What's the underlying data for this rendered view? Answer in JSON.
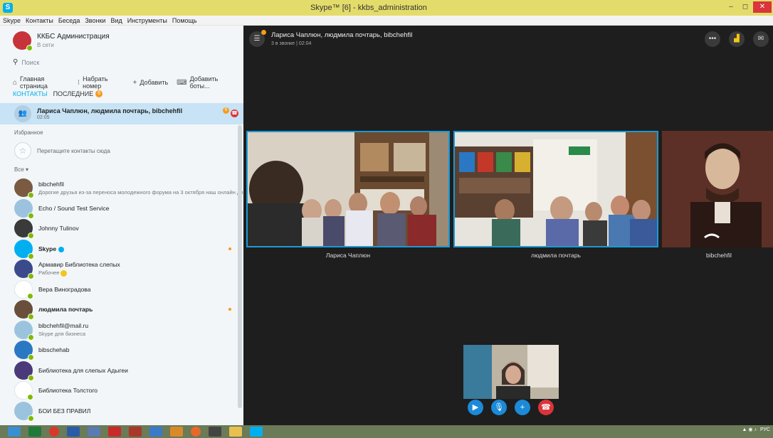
{
  "window": {
    "title": "Skype™ [6] - kkbs_administration",
    "controls": {
      "minimize": "–",
      "maximize": "◻",
      "close": "✕"
    }
  },
  "menu": [
    "Skype",
    "Контакты",
    "Беседа",
    "Звонки",
    "Вид",
    "Инструменты",
    "Помощь"
  ],
  "profile": {
    "name": "ККБС Администрация",
    "status": "В сети"
  },
  "search": {
    "placeholder": "Поиск"
  },
  "actions": {
    "home": "Главная страница",
    "dial": "Набрать номер",
    "add": "Добавить",
    "add_bots": "Добавить боты..."
  },
  "tabs": {
    "contacts": "КОНТАКТЫ",
    "recent": "ПОСЛЕДНИЕ",
    "recent_badge": "6"
  },
  "active_call": {
    "name": "Лариса Чаплюн, людмила почтарь, bibchehfil",
    "time": "02:05",
    "unread": "6"
  },
  "favorites": {
    "label": "Избранное",
    "hint": "Перетащите контакты сюда"
  },
  "all_label": "Все ▾",
  "contacts": [
    {
      "name": "bibchehfil",
      "mood": "Дорогие друзья из-за переноса молодежного форума на 3 октября наш онлайн диало...",
      "bold": false,
      "dot": false,
      "color": "#7a5a40"
    },
    {
      "name": "Echo / Sound Test Service",
      "mood": "",
      "bold": false,
      "dot": false,
      "color": "#9cc3de"
    },
    {
      "name": "Johnny Tulinov",
      "mood": "",
      "bold": false,
      "dot": false,
      "color": "#3a3a3a"
    },
    {
      "name": "Skype",
      "mood": "",
      "bold": true,
      "dot": true,
      "color": "#00aff0",
      "verified": true
    },
    {
      "name": "Армавир Библиотека слепых",
      "mood": "Рабочее",
      "bold": false,
      "dot": false,
      "color": "#3b4a8a",
      "emoji": true
    },
    {
      "name": "Вера Виноградова",
      "mood": "",
      "bold": false,
      "dot": false,
      "color": "#ffffff"
    },
    {
      "name": "людмила почтарь",
      "mood": "",
      "bold": true,
      "dot": true,
      "color": "#6a4e3c"
    },
    {
      "name": "bibchehfil@mail.ru",
      "mood": "Skype для бизнеса",
      "bold": false,
      "dot": false,
      "color": "#9cc3de"
    },
    {
      "name": "bibschehab",
      "mood": "",
      "bold": false,
      "dot": false,
      "color": "#2a78c4"
    },
    {
      "name": "Библиотека для слепых Адыгеи",
      "mood": "",
      "bold": false,
      "dot": false,
      "color": "#4a3a7a"
    },
    {
      "name": "Библиотека Толстого",
      "mood": "",
      "bold": false,
      "dot": false,
      "color": "#ffffff"
    },
    {
      "name": "БОИ БЕЗ ПРАВИЛ",
      "mood": "",
      "bold": false,
      "dot": false,
      "color": "#9cc3de"
    }
  ],
  "call": {
    "title": "Лариса Чаплюн, людмила почтарь, bibchehfil",
    "subtitle": "3 в звонке | 02:04",
    "participants": [
      "Лариса Чаплюн",
      "людмила почтарь",
      "bibchehfil"
    ]
  },
  "colors": {
    "accent": "#00aff0",
    "end_call": "#d9353a",
    "unread": "#f89b1c",
    "online": "#7fba00"
  }
}
